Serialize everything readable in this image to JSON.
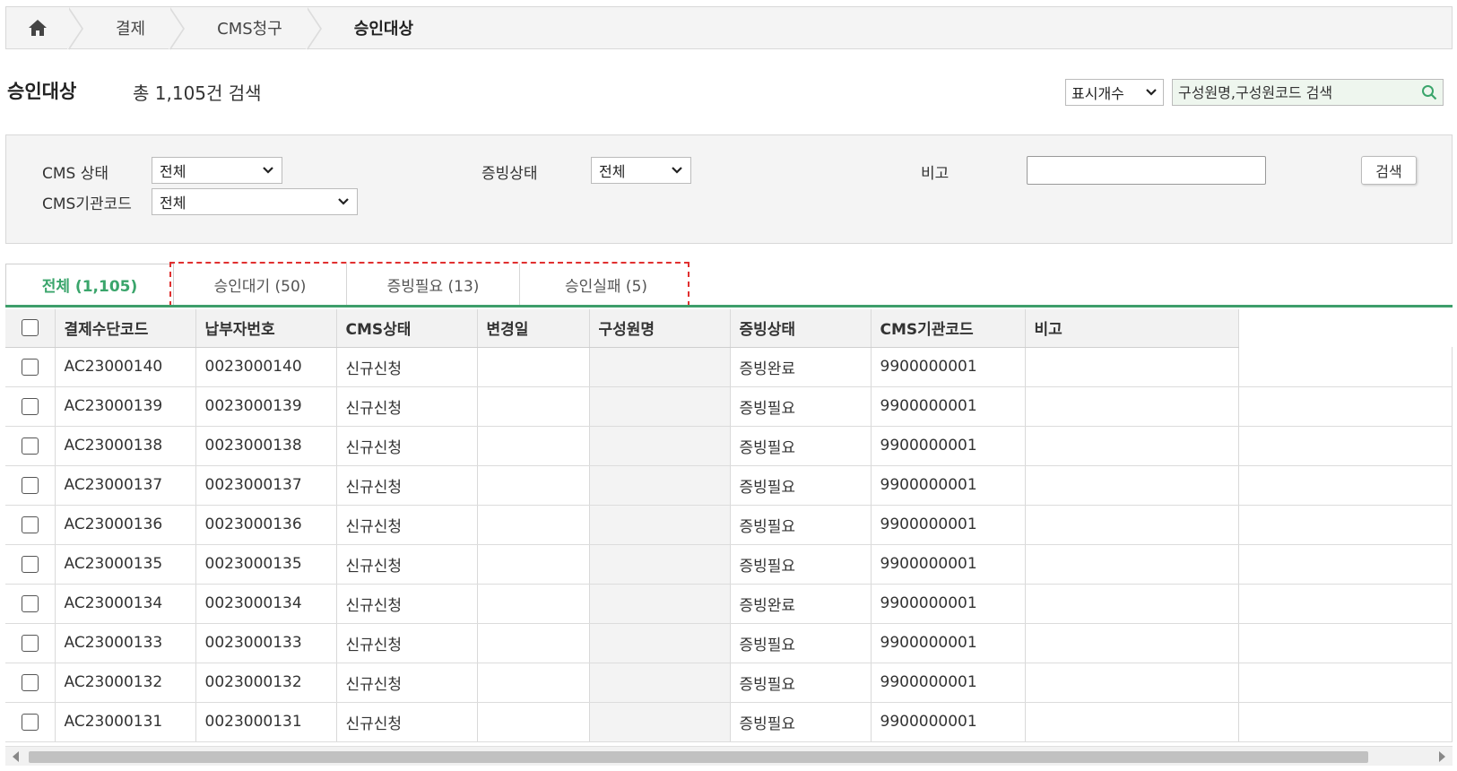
{
  "breadcrumb": {
    "home_icon": "home-icon",
    "items": [
      "결제",
      "CMS청구",
      "승인대상"
    ]
  },
  "header": {
    "title": "승인대상",
    "count_text": "총 1,105건 검색",
    "display_select": "표시개수",
    "search_placeholder": "구성원명,구성원코드 검색"
  },
  "filters": {
    "cms_status_label": "CMS 상태",
    "cms_status_value": "전체",
    "evidence_label": "증빙상태",
    "evidence_value": "전체",
    "remark_label": "비고",
    "remark_value": "",
    "search_button": "검색",
    "institution_label": "CMS기관코드",
    "institution_value": "전체"
  },
  "tabs": [
    {
      "label": "전체 (1,105)",
      "active": true
    },
    {
      "label": "승인대기 (50)",
      "active": false
    },
    {
      "label": "증빙필요 (13)",
      "active": false
    },
    {
      "label": "승인실패 (5)",
      "active": false
    }
  ],
  "table": {
    "columns": [
      "결제수단코드",
      "납부자번호",
      "CMS상태",
      "변경일",
      "구성원명",
      "증빙상태",
      "CMS기관코드",
      "비고"
    ],
    "rows": [
      [
        "AC23000140",
        "0023000140",
        "신규신청",
        "",
        "",
        "증빙완료",
        "9900000001",
        ""
      ],
      [
        "AC23000139",
        "0023000139",
        "신규신청",
        "",
        "",
        "증빙필요",
        "9900000001",
        ""
      ],
      [
        "AC23000138",
        "0023000138",
        "신규신청",
        "",
        "",
        "증빙필요",
        "9900000001",
        ""
      ],
      [
        "AC23000137",
        "0023000137",
        "신규신청",
        "",
        "",
        "증빙필요",
        "9900000001",
        ""
      ],
      [
        "AC23000136",
        "0023000136",
        "신규신청",
        "",
        "",
        "증빙필요",
        "9900000001",
        ""
      ],
      [
        "AC23000135",
        "0023000135",
        "신규신청",
        "",
        "",
        "증빙필요",
        "9900000001",
        ""
      ],
      [
        "AC23000134",
        "0023000134",
        "신규신청",
        "",
        "",
        "증빙완료",
        "9900000001",
        ""
      ],
      [
        "AC23000133",
        "0023000133",
        "신규신청",
        "",
        "",
        "증빙필요",
        "9900000001",
        ""
      ],
      [
        "AC23000132",
        "0023000132",
        "신규신청",
        "",
        "",
        "증빙필요",
        "9900000001",
        ""
      ],
      [
        "AC23000131",
        "0023000131",
        "신규신청",
        "",
        "",
        "증빙필요",
        "9900000001",
        ""
      ]
    ]
  },
  "colors": {
    "accent": "#3e9e6b",
    "highlight": "#e03030"
  }
}
